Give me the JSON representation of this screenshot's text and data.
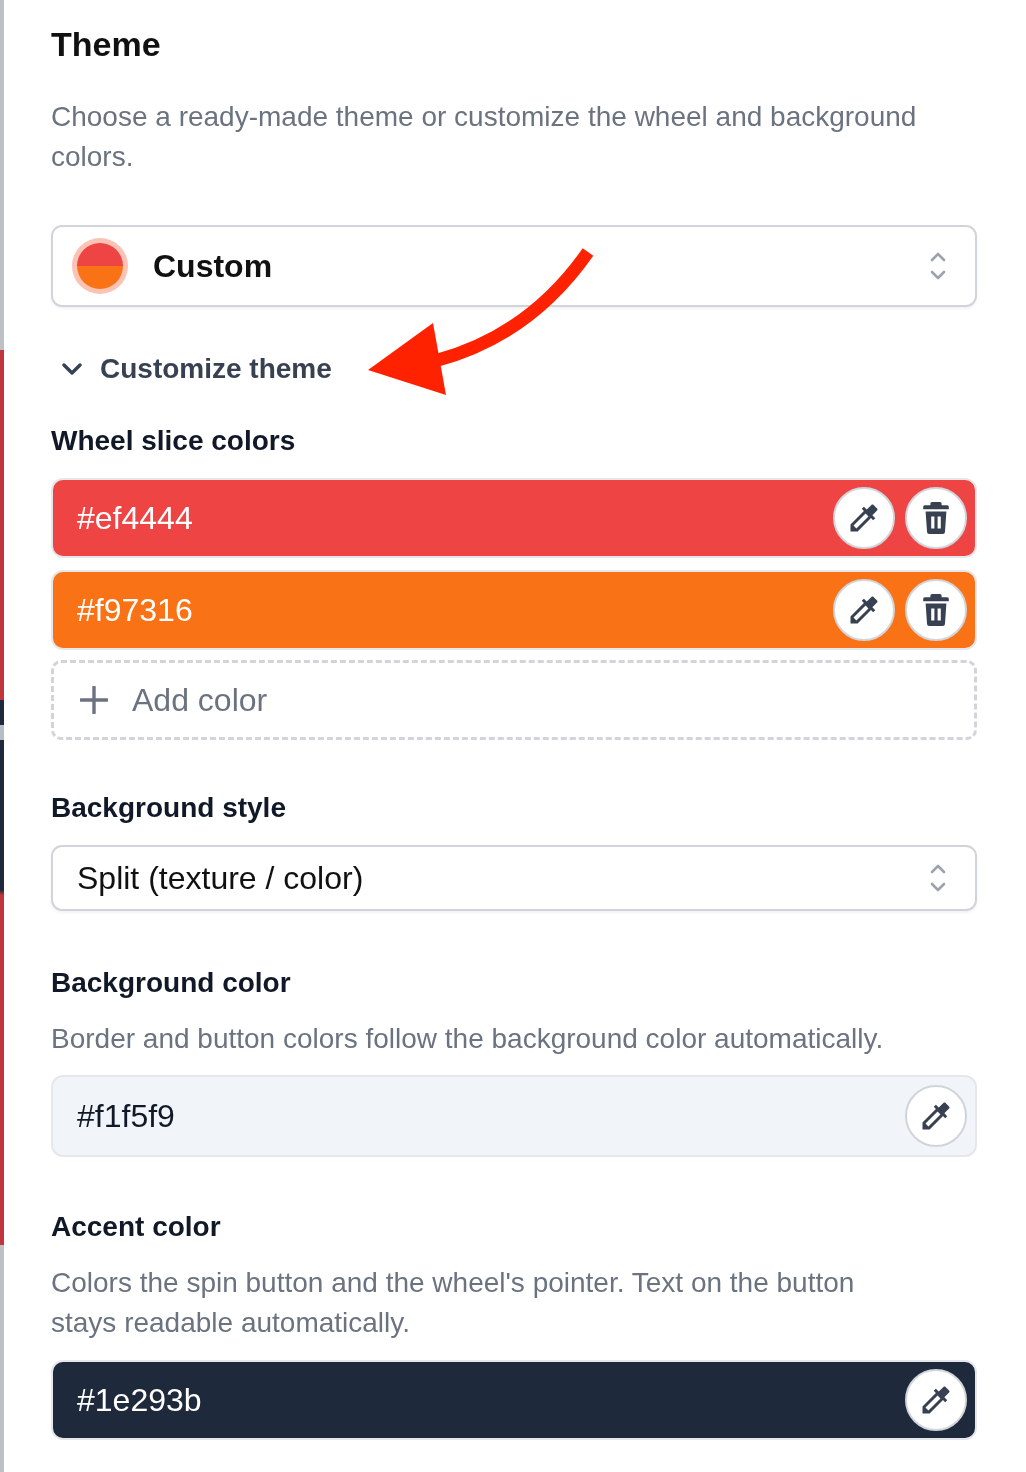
{
  "panel": {
    "title": "Theme",
    "description": "Choose a ready-made theme or customize the wheel and background colors."
  },
  "theme_select": {
    "value": "Custom"
  },
  "customize_toggle": {
    "label": "Customize theme",
    "expanded": true
  },
  "wheel_slice_colors": {
    "label": "Wheel slice colors",
    "items": [
      {
        "value": "#ef4444",
        "color": "#ef4444"
      },
      {
        "value": "#f97316",
        "color": "#f97316"
      }
    ],
    "add_button": "Add color"
  },
  "background_style": {
    "label": "Background style",
    "value": "Split (texture / color)"
  },
  "background_color": {
    "label": "Background color",
    "description": "Border and button colors follow the background color automatically.",
    "value": "#f1f5f9",
    "color": "#f1f5f9"
  },
  "accent_color": {
    "label": "Accent color",
    "description": "Colors the spin button and the wheel's pointer. Text on the button stays readable automatically.",
    "value": "#1e293b",
    "color": "#1e293b"
  }
}
